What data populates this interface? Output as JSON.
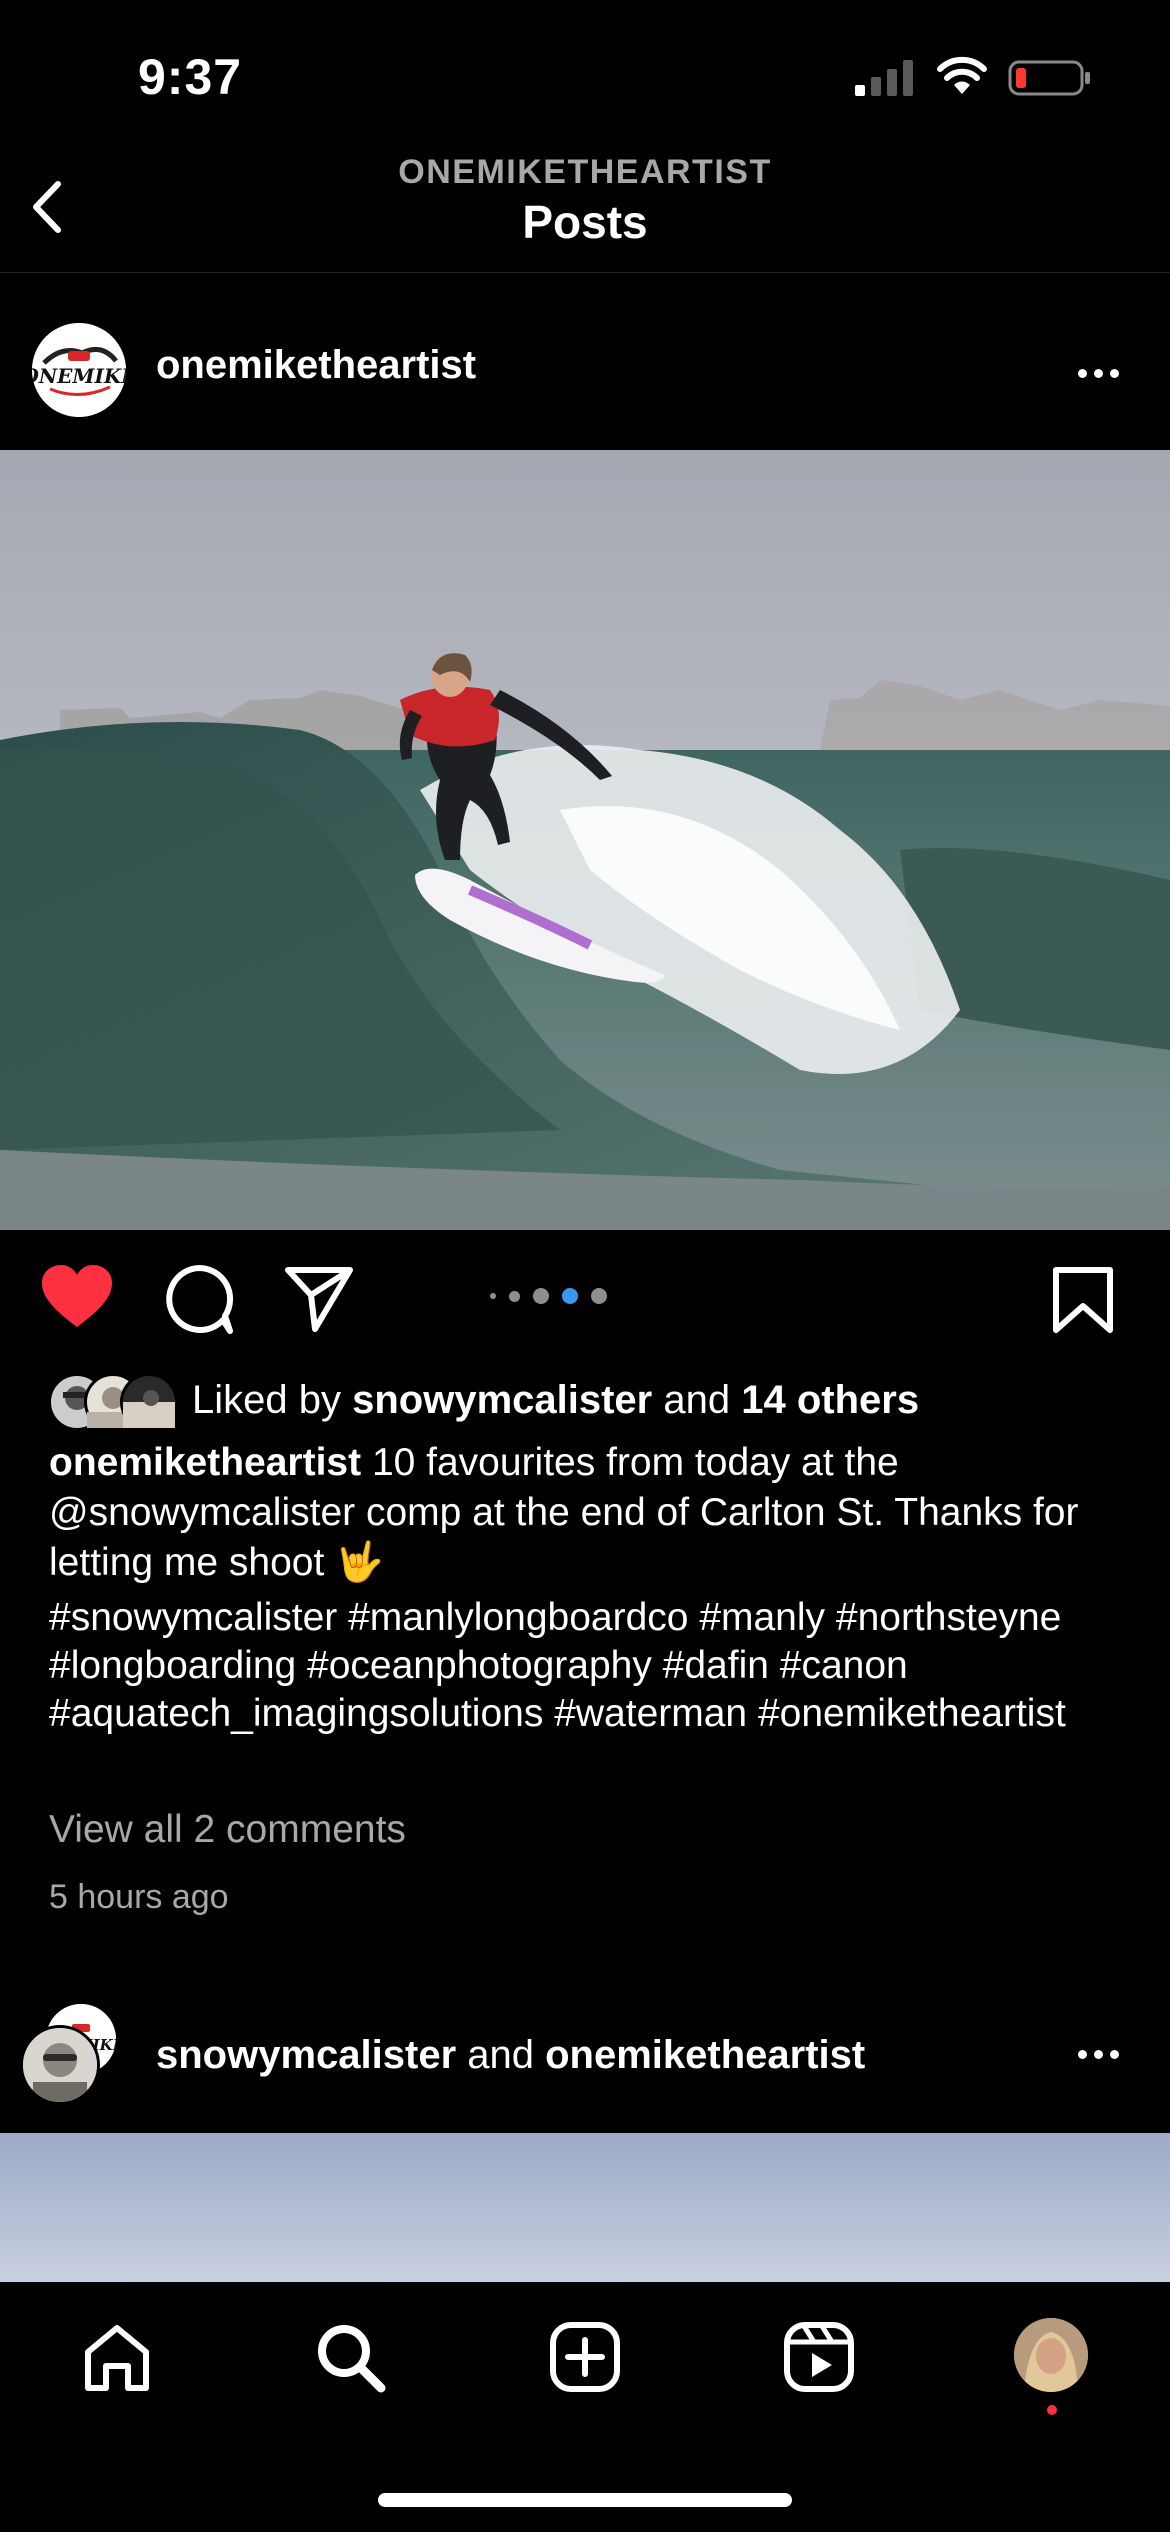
{
  "status_bar": {
    "time": "9:37"
  },
  "header": {
    "subtitle": "ONEMIKETHEARTIST",
    "title": "Posts"
  },
  "post1": {
    "username": "onemiketheartist",
    "carousel": {
      "count": 5,
      "active_index": 3
    },
    "liked": true,
    "likes": {
      "prefix": "Liked by ",
      "user": "snowymcalister",
      "joiner": " and ",
      "others": "14 others"
    },
    "caption": {
      "username": "onemiketheartist",
      "text": " 10 favourites from today at the @snowymcalister comp at the end of Carlton St. Thanks for letting me shoot 🤟"
    },
    "hashtags": "#snowymcalister #manlylongboardco #manly #northsteyne #longboarding #oceanphotography #dafin #canon #aquatech_imagingsolutions #waterman #onemiketheartist",
    "view_comments": "View all 2 comments",
    "time_ago": "5 hours ago"
  },
  "post2": {
    "user1": "snowymcalister",
    "joiner": " and ",
    "user2": "onemiketheartist"
  },
  "colors": {
    "like_red": "#ff3040",
    "carousel_active": "#3897f0",
    "background": "#000000"
  },
  "tab_bar": {
    "icons": [
      "home-icon",
      "search-icon",
      "create-icon",
      "reels-icon",
      "profile-avatar"
    ]
  }
}
